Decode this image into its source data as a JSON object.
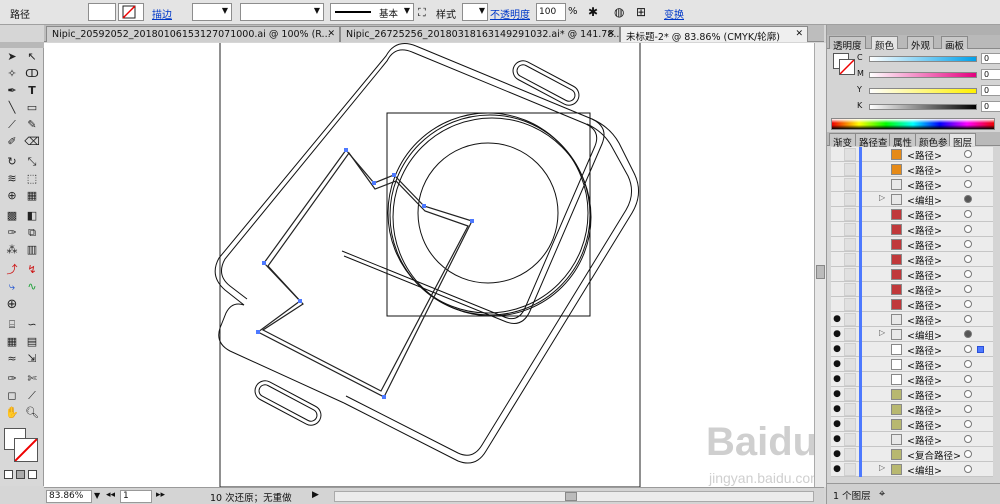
{
  "control_bar": {
    "selection_label": "路径",
    "stroke_label": "描边",
    "stroke_style": "基本",
    "style_label": "样式",
    "opacity_label": "不透明度",
    "opacity_value": "100",
    "opacity_unit": "%",
    "transform_label": "变换"
  },
  "doc_tabs": [
    {
      "title": "Nipic_20592052_20180106153127071000.ai @ 100% (R..."
    },
    {
      "title": "Nipic_26725256_20180318163149291032.ai* @ 141.78..."
    },
    {
      "title": "未标题-2* @ 83.86% (CMYK/轮廓)"
    }
  ],
  "status_bar": {
    "zoom": "83.86%",
    "page": "1",
    "history": "10 次还原；无重做"
  },
  "color_panel": {
    "tabs": [
      "透明度",
      "颜色",
      "外观",
      "画板"
    ],
    "active_tab": "颜色",
    "channels": [
      {
        "label": "C",
        "value": "0",
        "grad_end": "#00a0e9"
      },
      {
        "label": "M",
        "value": "0",
        "grad_end": "#e4007f"
      },
      {
        "label": "Y",
        "value": "0",
        "grad_end": "#fff100"
      },
      {
        "label": "K",
        "value": "0",
        "grad_end": "#000000"
      }
    ]
  },
  "layers_panel": {
    "tabs": [
      "渐变",
      "路径查",
      "属性",
      "颜色参",
      "图层"
    ],
    "active_tab": "图层",
    "rows": [
      {
        "name": "<路径>",
        "thumb": "#e58a18",
        "vis": false,
        "group": false,
        "target": "empty"
      },
      {
        "name": "<路径>",
        "thumb": "#e58a18",
        "vis": false,
        "group": false,
        "target": "empty"
      },
      {
        "name": "<路径>",
        "thumb": "#e8e8e8",
        "vis": false,
        "group": false,
        "target": "empty"
      },
      {
        "name": "<编组>",
        "thumb": "#e8e8e8",
        "vis": false,
        "group": true,
        "target": "filled"
      },
      {
        "name": "<路径>",
        "thumb": "#c0393b",
        "vis": false,
        "group": false,
        "target": "empty"
      },
      {
        "name": "<路径>",
        "thumb": "#c0393b",
        "vis": false,
        "group": false,
        "target": "empty"
      },
      {
        "name": "<路径>",
        "thumb": "#c0393b",
        "vis": false,
        "group": false,
        "target": "empty"
      },
      {
        "name": "<路径>",
        "thumb": "#c0393b",
        "vis": false,
        "group": false,
        "target": "empty"
      },
      {
        "name": "<路径>",
        "thumb": "#c0393b",
        "vis": false,
        "group": false,
        "target": "empty"
      },
      {
        "name": "<路径>",
        "thumb": "#c0393b",
        "vis": false,
        "group": false,
        "target": "empty"
      },
      {
        "name": "<路径>",
        "thumb": "#c0393b",
        "vis": false,
        "group": false,
        "target": "empty"
      },
      {
        "name": "<路径>",
        "thumb": "#e8e8e8",
        "vis": true,
        "group": false,
        "target": "empty"
      },
      {
        "name": "<编组>",
        "thumb": "#e8e8e8",
        "vis": true,
        "group": true,
        "target": "filled"
      },
      {
        "name": "<路径>",
        "thumb": "#ffffff",
        "vis": true,
        "group": false,
        "target": "selected"
      },
      {
        "name": "<路径>",
        "thumb": "#ffffff",
        "vis": true,
        "group": false,
        "target": "empty"
      },
      {
        "name": "<路径>",
        "thumb": "#ffffff",
        "vis": true,
        "group": false,
        "target": "empty"
      },
      {
        "name": "<路径>",
        "thumb": "#b8b870",
        "vis": true,
        "group": false,
        "target": "empty"
      },
      {
        "name": "<路径>",
        "thumb": "#b8b870",
        "vis": true,
        "group": false,
        "target": "empty"
      },
      {
        "name": "<路径>",
        "thumb": "#b8b870",
        "vis": true,
        "group": false,
        "target": "empty"
      },
      {
        "name": "<路径>",
        "thumb": "#e8e8e8",
        "vis": true,
        "group": false,
        "target": "empty"
      },
      {
        "name": "<复合路径>",
        "thumb": "#b8b870",
        "vis": true,
        "group": false,
        "target": "empty"
      },
      {
        "name": "<编组>",
        "thumb": "#b8b870",
        "vis": true,
        "group": true,
        "target": "empty"
      }
    ],
    "footer": "1 个图层"
  },
  "watermark": {
    "text": "Baidu 经验",
    "sub": "jingyan.baidu.com"
  }
}
